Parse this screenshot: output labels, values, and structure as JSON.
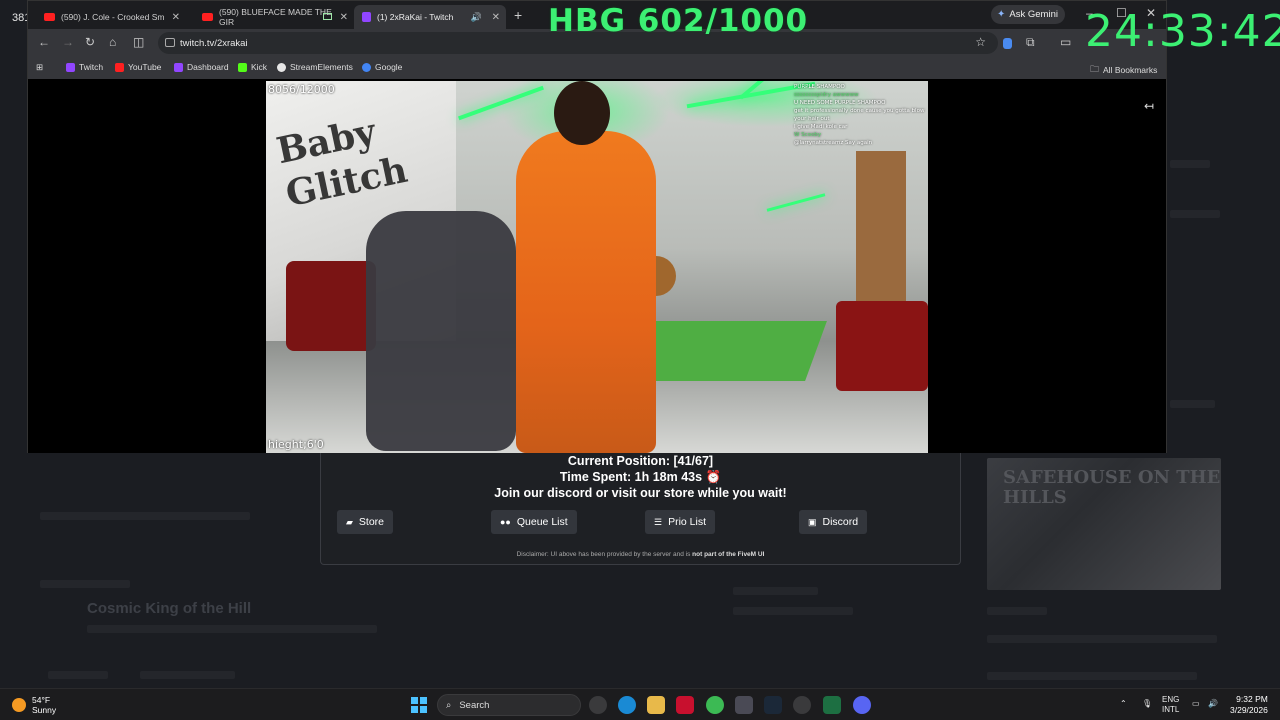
{
  "background_left_number": "381",
  "overlay": {
    "hbg_counter": "HBG 602/1000",
    "clock": "24:33:42"
  },
  "browser": {
    "tabs": [
      {
        "label": "(590) J. Cole - Crooked Sm",
        "favicon": "youtube-icon",
        "active": false
      },
      {
        "label": "(590) BLUEFACE MADE THE GIR",
        "favicon": "youtube-icon",
        "active": false
      },
      {
        "label": "(1) 2xRaKai - Twitch",
        "favicon": "twitch-icon",
        "active": true
      }
    ],
    "ask_gemini": "Ask Gemini",
    "url": "twitch.tv/2xrakai",
    "bookmarks": [
      {
        "label": "Twitch",
        "color": "#9146ff"
      },
      {
        "label": "YouTube",
        "color": "#ff2020"
      },
      {
        "label": "Dashboard",
        "color": "#9146ff"
      },
      {
        "label": "Kick",
        "color": "#53fc18"
      },
      {
        "label": "StreamElements",
        "color": "#e6e6e6"
      },
      {
        "label": "Google",
        "color": "#4285f4"
      }
    ],
    "all_bookmarks": "All Bookmarks"
  },
  "stream": {
    "top_label": "8056/12000",
    "bottom_label": "hieght;6'0",
    "wall_text": "Baby Glitch",
    "chat": [
      {
        "name": "",
        "text": "PURPLE SHAMPOO"
      },
      {
        "name": "",
        "text": "sssssssspidry awwwww"
      },
      {
        "name": "",
        "text": "U NEED SOME PURPLE SHAMPOO"
      },
      {
        "name": "",
        "text": "get it professionally done cause you gotta blow your hair out"
      },
      {
        "name": "",
        "text": "I give Madi kole car"
      },
      {
        "name": "",
        "text": "W Scooby"
      },
      {
        "name": "",
        "text": "@larrynatstreamz Say again"
      }
    ]
  },
  "queue": {
    "position": "Current Position: [41/67]",
    "time_spent": "Time Spent: 1h 18m 43s ⏰",
    "message": "Join our discord or visit our store while you wait!",
    "buttons": [
      {
        "label": "Store",
        "icon": "cart-icon"
      },
      {
        "label": "Queue List",
        "icon": "users-icon"
      },
      {
        "label": "Prio List",
        "icon": "list-icon"
      },
      {
        "label": "Discord",
        "icon": "discord-icon"
      }
    ],
    "disclaimer_prefix": "Disclaimer: UI above has been provided by the server and is ",
    "disclaimer_bold": "not part of the FiveM UI"
  },
  "background": {
    "poster_text": "SAFEHOUSE ON THE HILLS",
    "game_title": "Cosmic King of the Hill"
  },
  "taskbar": {
    "weather_temp": "54°F",
    "weather_desc": "Sunny",
    "search_placeholder": "Search",
    "lang_top": "ENG",
    "lang_bottom": "INTL",
    "time": "9:32 PM",
    "date": "3/29/2026"
  }
}
